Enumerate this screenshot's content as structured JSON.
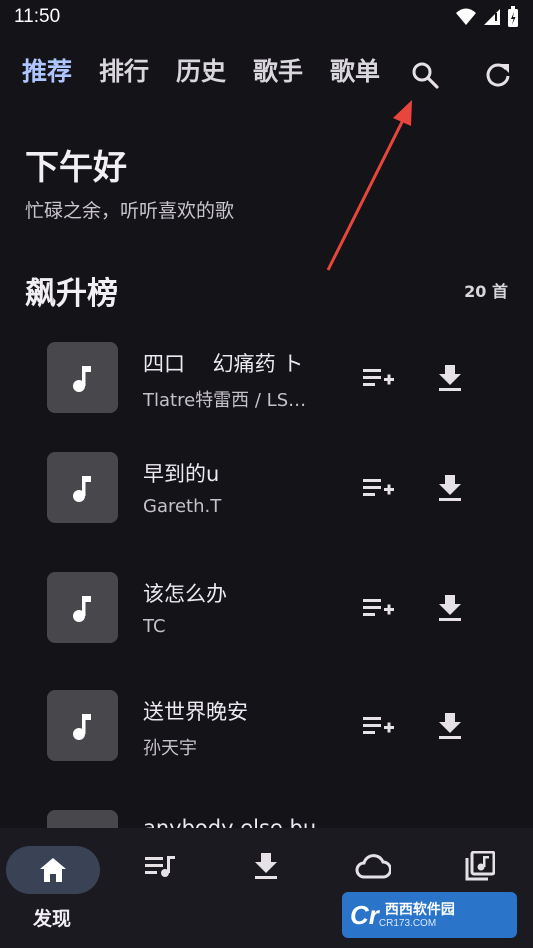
{
  "status": {
    "time": "11:50"
  },
  "tabs": [
    "推荐",
    "排行",
    "历史",
    "歌手",
    "歌单"
  ],
  "icons": {
    "search": "search-icon",
    "refresh": "refresh-icon"
  },
  "greeting": {
    "title": "下午好",
    "subtitle": "忙碌之余，听听喜欢的歌"
  },
  "section": {
    "title": "飙升榜",
    "count": "20 首"
  },
  "songs": [
    {
      "title": "四口　  幻痛药 ト",
      "artist": "Tlatre特雷西 / LS…"
    },
    {
      "title": "早到的u",
      "artist": "Gareth.T"
    },
    {
      "title": "该怎么办",
      "artist": "TC"
    },
    {
      "title": "送世界晚安",
      "artist": "孙天宇"
    },
    {
      "title": "anybody else bu",
      "artist": ""
    }
  ],
  "bottom_nav": {
    "active_label": "发现"
  },
  "watermark": {
    "logo": "Cr",
    "text": "西西软件园",
    "sub": "CR173.COM"
  },
  "colors": {
    "accent": "#aec6ff",
    "background": "#131318",
    "pill": "#3a4256",
    "arrow": "#e8453c"
  }
}
